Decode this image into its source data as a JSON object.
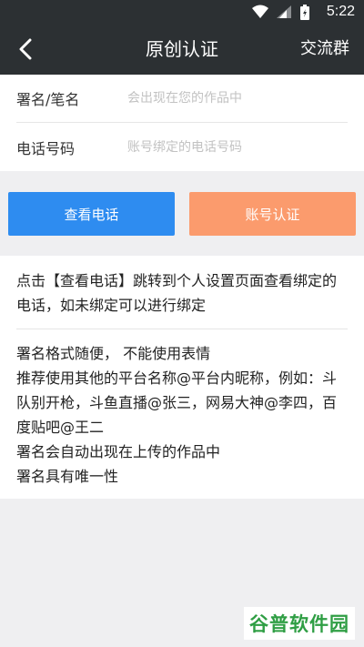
{
  "status_bar": {
    "time": "5:22"
  },
  "nav": {
    "title": "原创认证",
    "action": "交流群"
  },
  "form": {
    "signature": {
      "label": "署名/笔名",
      "placeholder": "会出现在您的作品中"
    },
    "phone": {
      "label": "电话号码",
      "placeholder": "账号绑定的电话号码"
    }
  },
  "buttons": {
    "view_phone": "查看电话",
    "verify_account": "账号认证"
  },
  "colors": {
    "header": "#2c3033",
    "blue": "#2e8cf0",
    "orange": "#fb9b6d"
  },
  "info": {
    "paragraph": "点击【查看电话】跳转到个人设置页面查看绑定的电话，如未绑定可以进行绑定",
    "lines": [
      "署名格式随便， 不能使用表情",
      "推荐使用其他的平台名称@平台内昵称，例如：斗队别开枪，斗鱼直播@张三，网易大神@李四，百度贴吧@王二",
      "署名会自动出现在上传的作品中",
      "署名具有唯一性"
    ]
  },
  "watermark": "谷普软件园"
}
